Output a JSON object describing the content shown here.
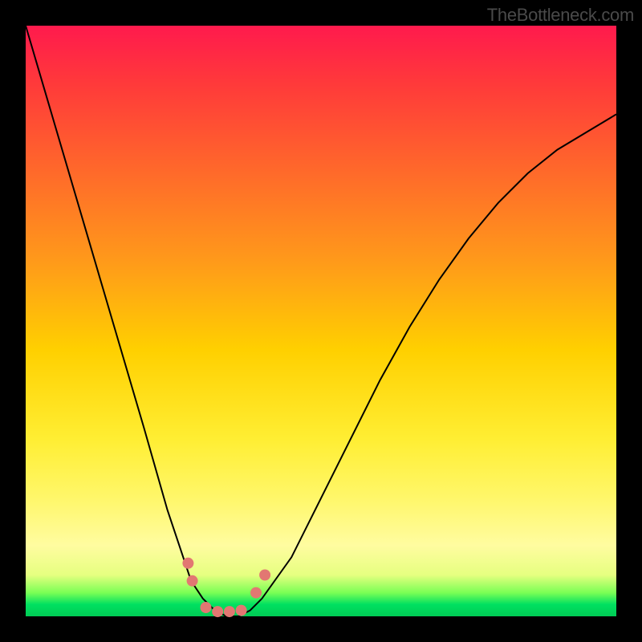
{
  "brand": "TheBottleneck.com",
  "chart_data": {
    "type": "line",
    "title": "",
    "xlabel": "",
    "ylabel": "",
    "xlim": [
      0,
      100
    ],
    "ylim": [
      0,
      100
    ],
    "series": [
      {
        "name": "curve",
        "x": [
          0,
          5,
          10,
          15,
          20,
          22,
          24,
          26,
          28,
          30,
          32,
          34,
          36,
          38,
          40,
          45,
          50,
          55,
          60,
          65,
          70,
          75,
          80,
          85,
          90,
          95,
          100
        ],
        "y": [
          100,
          83,
          66,
          49,
          32,
          25,
          18,
          12,
          6,
          3,
          1,
          0,
          0,
          1,
          3,
          10,
          20,
          30,
          40,
          49,
          57,
          64,
          70,
          75,
          79,
          82,
          85
        ]
      }
    ],
    "markers": [
      {
        "x": 27.5,
        "y": 9
      },
      {
        "x": 28.2,
        "y": 6
      },
      {
        "x": 30.5,
        "y": 1.5
      },
      {
        "x": 32.5,
        "y": 0.8
      },
      {
        "x": 34.5,
        "y": 0.8
      },
      {
        "x": 36.5,
        "y": 1
      },
      {
        "x": 39,
        "y": 4
      },
      {
        "x": 40.5,
        "y": 7
      }
    ],
    "gradient_stops": [
      {
        "pos": 0,
        "color": "#ff1a4d"
      },
      {
        "pos": 55,
        "color": "#ffd000"
      },
      {
        "pos": 98,
        "color": "#00e060"
      }
    ]
  }
}
